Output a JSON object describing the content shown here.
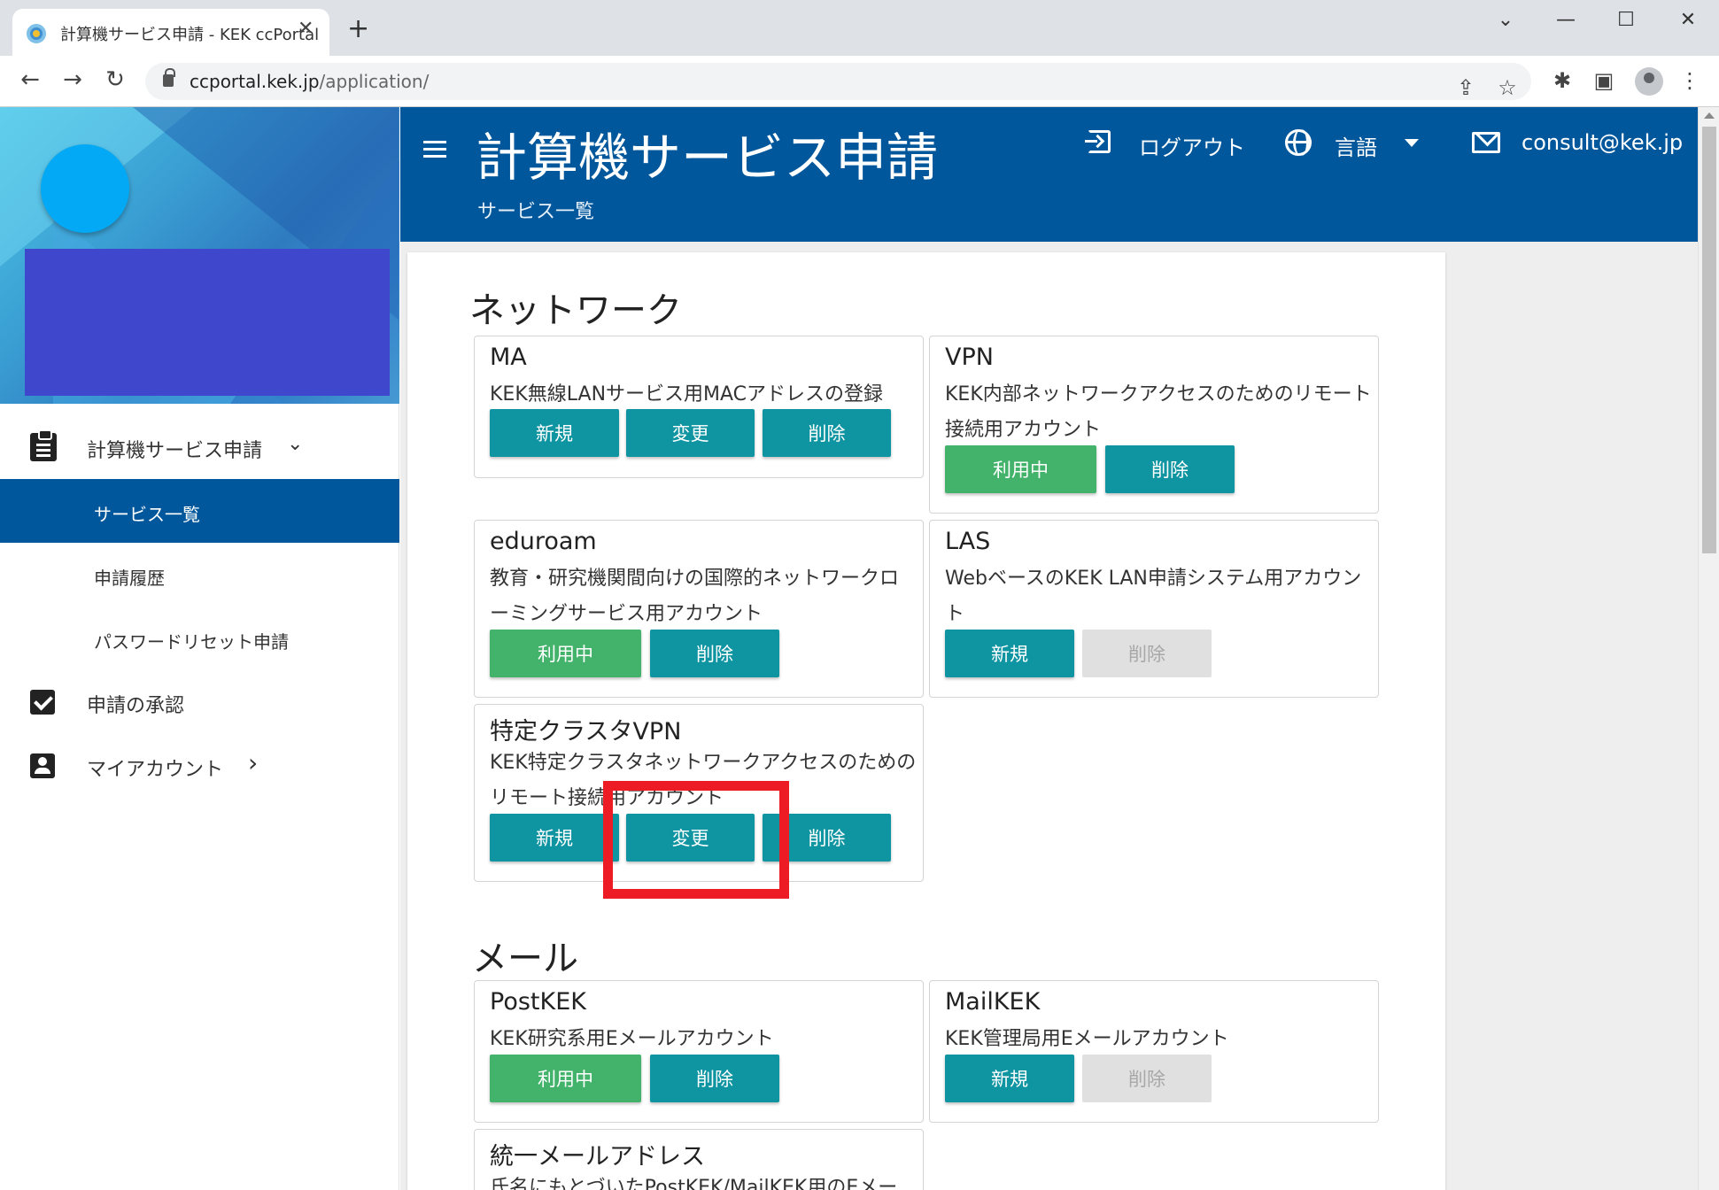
{
  "browser": {
    "tab_title": "計算機サービス申請 - KEK ccPortal",
    "tab_close": "✕",
    "new_tab": "+",
    "url_host": "ccportal.kek.jp",
    "url_path": "/application/",
    "back": "←",
    "forward": "→",
    "reload": "↻",
    "share": "⇪",
    "star": "☆",
    "extensions": "✱",
    "sidepanel": "▣",
    "menu": "⋮",
    "win_chevron": "⌄",
    "win_min": "—",
    "win_max": "☐",
    "win_close": "✕"
  },
  "sidebar": {
    "menu_group_label": "計算機サービス申請",
    "menu_group_caret": "⌄",
    "sub_items": [
      {
        "label": "サービス一覧",
        "active": true
      },
      {
        "label": "申請履歴",
        "active": false
      },
      {
        "label": "パスワードリセット申請",
        "active": false
      }
    ],
    "approval_label": "申請の承認",
    "account_label": "マイアカウント",
    "account_caret": "›"
  },
  "header": {
    "title": "計算機サービス申請",
    "subtitle": "サービス一覧",
    "logout_label": "ログアウト",
    "language_label": "言語",
    "contact_email": "consult@kek.jp"
  },
  "sections": {
    "network_title": "ネットワーク",
    "mail_title": "メール"
  },
  "services": {
    "ma": {
      "name": "MA",
      "desc": "KEK無線LANサービス用MACアドレスの登録",
      "btn1": "新規",
      "btn2": "変更",
      "btn3": "削除"
    },
    "vpn": {
      "name": "VPN",
      "desc": "KEK内部ネットワークアクセスのためのリモート接続用アカウント",
      "btn1": "利用中",
      "btn2": "削除"
    },
    "eduroam": {
      "name": "eduroam",
      "desc": "教育・研究機関間向けの国際的ネットワークローミングサービス用アカウント",
      "btn1": "利用中",
      "btn2": "削除"
    },
    "las": {
      "name": "LAS",
      "desc": "WebベースのKEK LAN申請システム用アカウント",
      "btn1": "新規",
      "btn2": "削除"
    },
    "cluster_vpn": {
      "name": "特定クラスタVPN",
      "desc": "KEK特定クラスタネットワークアクセスのためのリモート接続用アカウント",
      "btn1": "新規",
      "btn2": "変更",
      "btn3": "削除"
    },
    "postkek": {
      "name": "PostKEK",
      "desc": "KEK研究系用Eメールアカウント",
      "btn1": "利用中",
      "btn2": "削除"
    },
    "mailkek": {
      "name": "MailKEK",
      "desc": "KEK管理局用Eメールアカウント",
      "btn1": "新規",
      "btn2": "削除"
    },
    "unified_mail": {
      "name": "統一メールアドレス",
      "desc": "氏名にもとづいたPostKEK/MailKEK用のEメー"
    }
  },
  "colors": {
    "header_blue": "#01579b",
    "button_teal": "#0f94a2",
    "button_green": "#43b36b",
    "button_disabled": "#e0e0e0",
    "highlight_red": "#ed1c24"
  }
}
